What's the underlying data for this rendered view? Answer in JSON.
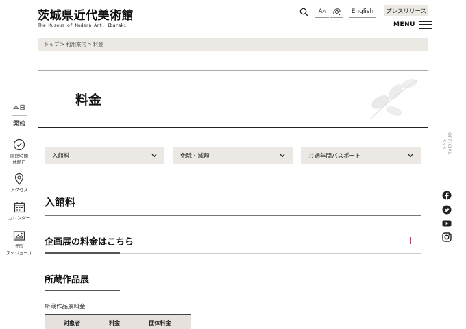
{
  "header": {
    "logo_jp": "茨城県近代美術館",
    "logo_en": "The Museum of Modern Art, Ibaraki",
    "font_size_label_big": "A",
    "font_size_label_small": "A",
    "english_label": "English",
    "press_label": "プレスリリース",
    "menu_label": "MENU"
  },
  "breadcrumb": [
    "トップ",
    "> 利用案内",
    "> 料金"
  ],
  "page": {
    "title": "料金"
  },
  "sidebar": {
    "today_line1": "本日",
    "today_line2": "開館",
    "items": [
      {
        "label": "開館時間\n休館日",
        "icon": "clock-icon"
      },
      {
        "label": "アクセス",
        "icon": "map-pin-icon"
      },
      {
        "label": "カレンダー",
        "icon": "calendar-icon"
      },
      {
        "label": "年間\nスケジュール",
        "icon": "schedule-icon"
      }
    ]
  },
  "social": {
    "label": "OFFICIAL SNS",
    "items": [
      "facebook-icon",
      "twitter-icon",
      "youtube-icon",
      "instagram-icon"
    ]
  },
  "tabs": [
    {
      "label": "入館料"
    },
    {
      "label": "免除・減額"
    },
    {
      "label": "共通年間パスポート"
    }
  ],
  "section": {
    "heading": "入館料",
    "accordion_title": "企画展の料金はこちら",
    "subheading": "所蔵作品展",
    "table_caption": "所蔵作品展料金",
    "table_headers": [
      "対象者",
      "料金",
      "団体料金"
    ]
  },
  "colors": {
    "accent": "#b24a5a",
    "beige": "#ece8e4",
    "text": "#222222"
  }
}
